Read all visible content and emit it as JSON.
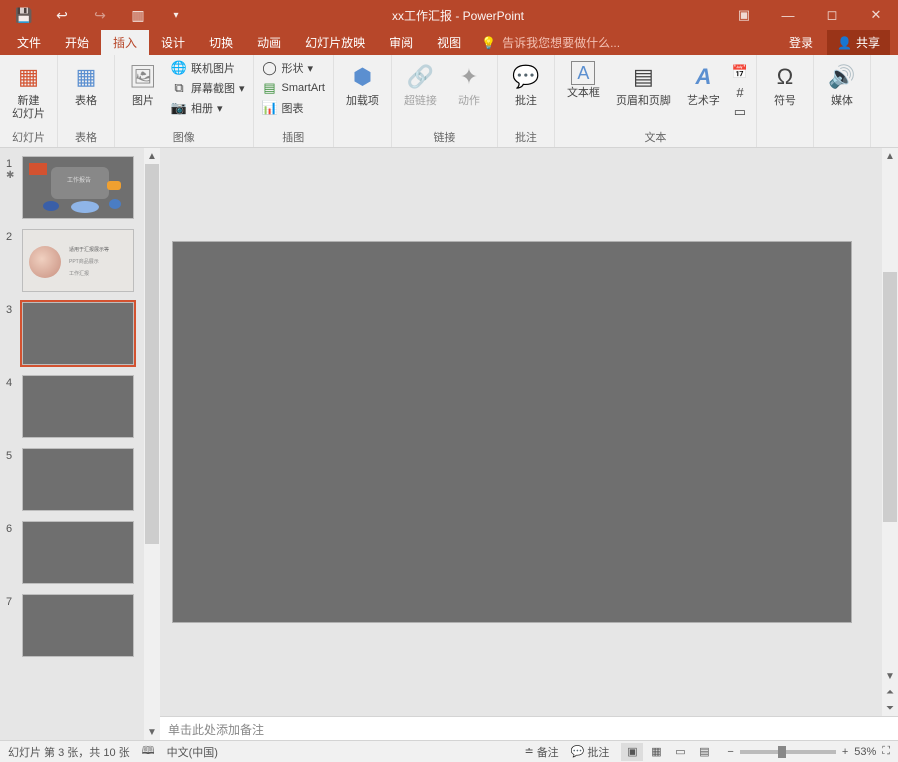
{
  "titlebar": {
    "title": "xx工作汇报 - PowerPoint"
  },
  "menu": {
    "file": "文件",
    "home": "开始",
    "insert": "插入",
    "design": "设计",
    "transition": "切换",
    "animation": "动画",
    "slideshow": "幻灯片放映",
    "review": "审阅",
    "view": "视图",
    "tellme": "告诉我您想要做什么...",
    "login": "登录",
    "share": "共享"
  },
  "ribbon": {
    "groups": {
      "slides": "幻灯片",
      "tables": "表格",
      "images": "图像",
      "illustrations": "插图",
      "addins": "加载项",
      "links": "链接",
      "comments": "批注",
      "text": "文本",
      "symbols": "符号",
      "media": "媒体"
    },
    "buttons": {
      "newslide": "新建\n幻灯片",
      "table": "表格",
      "picture": "图片",
      "onlinepic": "联机图片",
      "screenshot": "屏幕截图",
      "album": "相册",
      "shapes": "形状",
      "smartart": "SmartArt",
      "chart": "图表",
      "addin": "加载项",
      "hyperlink": "超链接",
      "action": "动作",
      "comment": "批注",
      "textbox": "文本框",
      "headerfooter": "页眉和页脚",
      "wordart": "艺术字",
      "symbol": "符号",
      "media": "媒体"
    }
  },
  "thumbs": {
    "t1_label": "工作报告",
    "t2_l1": "适用于汇报展示等",
    "t2_l2": "PPT商品展示",
    "t2_l3": "工作汇报"
  },
  "notes": {
    "placeholder": "单击此处添加备注"
  },
  "status": {
    "slideinfo": "幻灯片 第 3 张，共 10 张",
    "lang": "中文(中国)",
    "notes": "备注",
    "comments": "批注",
    "zoom": "53%"
  }
}
